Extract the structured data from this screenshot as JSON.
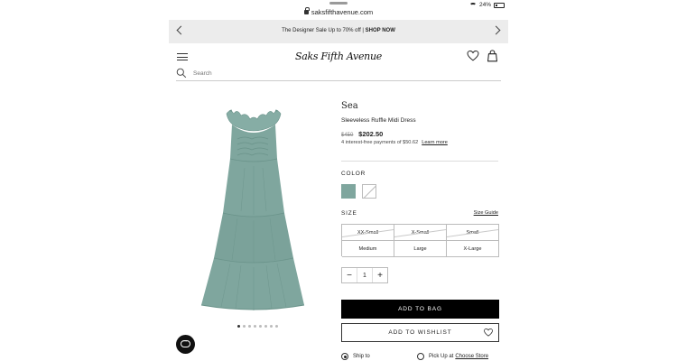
{
  "status_bar": {
    "url": "saksfifthavenue.com",
    "battery": "24%",
    "battery_level": 0.24
  },
  "promo": {
    "text": "The Designer Sale Up to 70% off | ",
    "cta": "SHOP NOW"
  },
  "header": {
    "logo": "Saks Fifth Avenue",
    "search_placeholder": "Search"
  },
  "carousel": {
    "image_count": 8,
    "active_index": 0
  },
  "product": {
    "brand": "Sea",
    "name": "Sleeveless Ruffle Midi Dress",
    "original_price": "$450",
    "sale_price": "$202.50",
    "installment_text": "4 interest-free payments of $50.62",
    "installment_link": "Learn more"
  },
  "color": {
    "label": "COLOR",
    "swatches": [
      {
        "name": "sage",
        "hex": "#7fa69e",
        "available": true,
        "selected": true
      },
      {
        "name": "white",
        "hex": "#ffffff",
        "available": false,
        "selected": false
      }
    ]
  },
  "size": {
    "label": "SIZE",
    "guide_label": "Size Guide",
    "options": [
      {
        "label": "XX-Small",
        "available": false
      },
      {
        "label": "X-Small",
        "available": false
      },
      {
        "label": "Small",
        "available": false
      },
      {
        "label": "Medium",
        "available": true
      },
      {
        "label": "Large",
        "available": true
      },
      {
        "label": "X-Large",
        "available": true
      }
    ]
  },
  "quantity": {
    "minus": "−",
    "value": "1",
    "plus": "+"
  },
  "actions": {
    "add_to_bag": "ADD TO BAG",
    "add_to_wishlist": "ADD TO WISHLIST"
  },
  "fulfillment": {
    "ship_label": "Ship to",
    "pickup_label": "Pick Up at",
    "choose_store": "Choose Store"
  },
  "colors": {
    "dress": "#7fa69e",
    "dress_dark": "#6a938a",
    "button_primary": "#000000"
  }
}
